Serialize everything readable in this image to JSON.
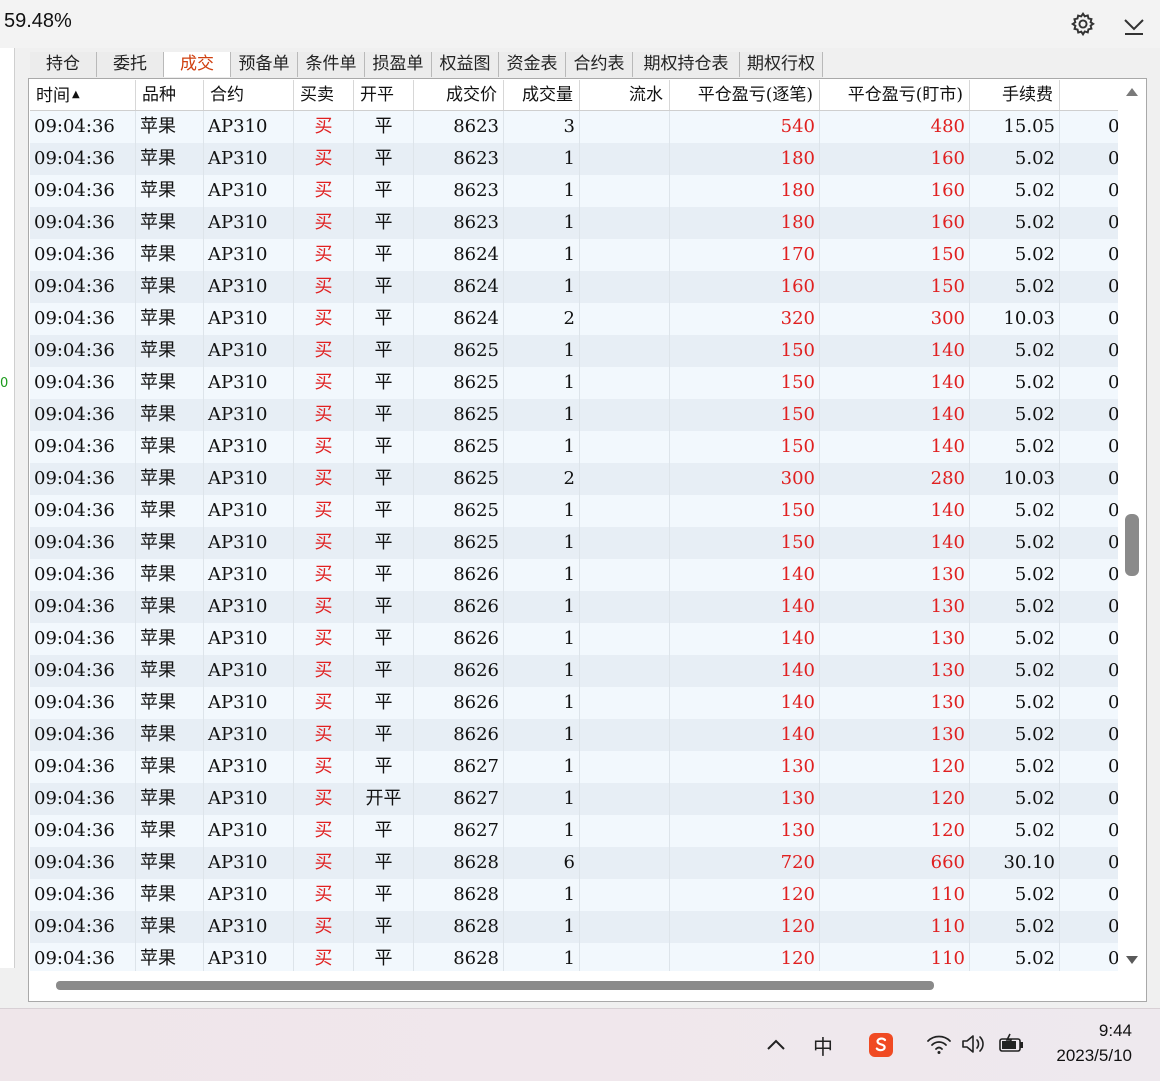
{
  "topbar": {
    "percent": "59.48%",
    "icons": [
      "gear-icon",
      "chevron-down-icon"
    ]
  },
  "leftstrip": {
    "mark": "0"
  },
  "tabs": [
    {
      "label": "持仓",
      "active": false
    },
    {
      "label": "委托",
      "active": false
    },
    {
      "label": "成交",
      "active": true
    },
    {
      "label": "预备单",
      "active": false
    },
    {
      "label": "条件单",
      "active": false
    },
    {
      "label": "损盈单",
      "active": false
    },
    {
      "label": "权益图",
      "active": false
    },
    {
      "label": "资金表",
      "active": false
    },
    {
      "label": "合约表",
      "active": false
    },
    {
      "label": "期权持仓表",
      "active": false
    },
    {
      "label": "期权行权",
      "active": false
    }
  ],
  "table": {
    "columns": [
      "时间",
      "品种",
      "合约",
      "买卖",
      "开平",
      "成交价",
      "成交量",
      "流水",
      "平仓盈亏(逐笔)",
      "平仓盈亏(盯市)",
      "手续费"
    ],
    "sort_column": "时间",
    "sort_indicator": "▲",
    "trailing_cell": "0",
    "rows": [
      [
        "09:04:36",
        "苹果",
        "AP310",
        "买",
        "平",
        "8623",
        "3",
        "",
        "540",
        "480",
        "15.05"
      ],
      [
        "09:04:36",
        "苹果",
        "AP310",
        "买",
        "平",
        "8623",
        "1",
        "",
        "180",
        "160",
        "5.02"
      ],
      [
        "09:04:36",
        "苹果",
        "AP310",
        "买",
        "平",
        "8623",
        "1",
        "",
        "180",
        "160",
        "5.02"
      ],
      [
        "09:04:36",
        "苹果",
        "AP310",
        "买",
        "平",
        "8623",
        "1",
        "",
        "180",
        "160",
        "5.02"
      ],
      [
        "09:04:36",
        "苹果",
        "AP310",
        "买",
        "平",
        "8624",
        "1",
        "",
        "170",
        "150",
        "5.02"
      ],
      [
        "09:04:36",
        "苹果",
        "AP310",
        "买",
        "平",
        "8624",
        "1",
        "",
        "160",
        "150",
        "5.02"
      ],
      [
        "09:04:36",
        "苹果",
        "AP310",
        "买",
        "平",
        "8624",
        "2",
        "",
        "320",
        "300",
        "10.03"
      ],
      [
        "09:04:36",
        "苹果",
        "AP310",
        "买",
        "平",
        "8625",
        "1",
        "",
        "150",
        "140",
        "5.02"
      ],
      [
        "09:04:36",
        "苹果",
        "AP310",
        "买",
        "平",
        "8625",
        "1",
        "",
        "150",
        "140",
        "5.02"
      ],
      [
        "09:04:36",
        "苹果",
        "AP310",
        "买",
        "平",
        "8625",
        "1",
        "",
        "150",
        "140",
        "5.02"
      ],
      [
        "09:04:36",
        "苹果",
        "AP310",
        "买",
        "平",
        "8625",
        "1",
        "",
        "150",
        "140",
        "5.02"
      ],
      [
        "09:04:36",
        "苹果",
        "AP310",
        "买",
        "平",
        "8625",
        "2",
        "",
        "300",
        "280",
        "10.03"
      ],
      [
        "09:04:36",
        "苹果",
        "AP310",
        "买",
        "平",
        "8625",
        "1",
        "",
        "150",
        "140",
        "5.02"
      ],
      [
        "09:04:36",
        "苹果",
        "AP310",
        "买",
        "平",
        "8625",
        "1",
        "",
        "150",
        "140",
        "5.02"
      ],
      [
        "09:04:36",
        "苹果",
        "AP310",
        "买",
        "平",
        "8626",
        "1",
        "",
        "140",
        "130",
        "5.02"
      ],
      [
        "09:04:36",
        "苹果",
        "AP310",
        "买",
        "平",
        "8626",
        "1",
        "",
        "140",
        "130",
        "5.02"
      ],
      [
        "09:04:36",
        "苹果",
        "AP310",
        "买",
        "平",
        "8626",
        "1",
        "",
        "140",
        "130",
        "5.02"
      ],
      [
        "09:04:36",
        "苹果",
        "AP310",
        "买",
        "平",
        "8626",
        "1",
        "",
        "140",
        "130",
        "5.02"
      ],
      [
        "09:04:36",
        "苹果",
        "AP310",
        "买",
        "平",
        "8626",
        "1",
        "",
        "140",
        "130",
        "5.02"
      ],
      [
        "09:04:36",
        "苹果",
        "AP310",
        "买",
        "平",
        "8626",
        "1",
        "",
        "140",
        "130",
        "5.02"
      ],
      [
        "09:04:36",
        "苹果",
        "AP310",
        "买",
        "平",
        "8627",
        "1",
        "",
        "130",
        "120",
        "5.02"
      ],
      [
        "09:04:36",
        "苹果",
        "AP310",
        "买",
        "开平",
        "8627",
        "1",
        "",
        "130",
        "120",
        "5.02"
      ],
      [
        "09:04:36",
        "苹果",
        "AP310",
        "买",
        "平",
        "8627",
        "1",
        "",
        "130",
        "120",
        "5.02"
      ],
      [
        "09:04:36",
        "苹果",
        "AP310",
        "买",
        "平",
        "8628",
        "6",
        "",
        "720",
        "660",
        "30.10"
      ],
      [
        "09:04:36",
        "苹果",
        "AP310",
        "买",
        "平",
        "8628",
        "1",
        "",
        "120",
        "110",
        "5.02"
      ],
      [
        "09:04:36",
        "苹果",
        "AP310",
        "买",
        "平",
        "8628",
        "1",
        "",
        "120",
        "110",
        "5.02"
      ],
      [
        "09:04:36",
        "苹果",
        "AP310",
        "买",
        "平",
        "8628",
        "1",
        "",
        "120",
        "110",
        "5.02"
      ]
    ]
  },
  "taskbar": {
    "ime_label": "中",
    "time": "9:44",
    "date": "2023/5/10",
    "icons": [
      "chevron-up-icon",
      "ime-icon",
      "sogou-icon",
      "wifi-icon",
      "volume-icon",
      "battery-icon"
    ]
  },
  "colors": {
    "sell_buy_red": "#e02020",
    "row_odd": "#f2f8fd",
    "row_even": "#e7eef5",
    "active_tab_text": "#d04010"
  }
}
